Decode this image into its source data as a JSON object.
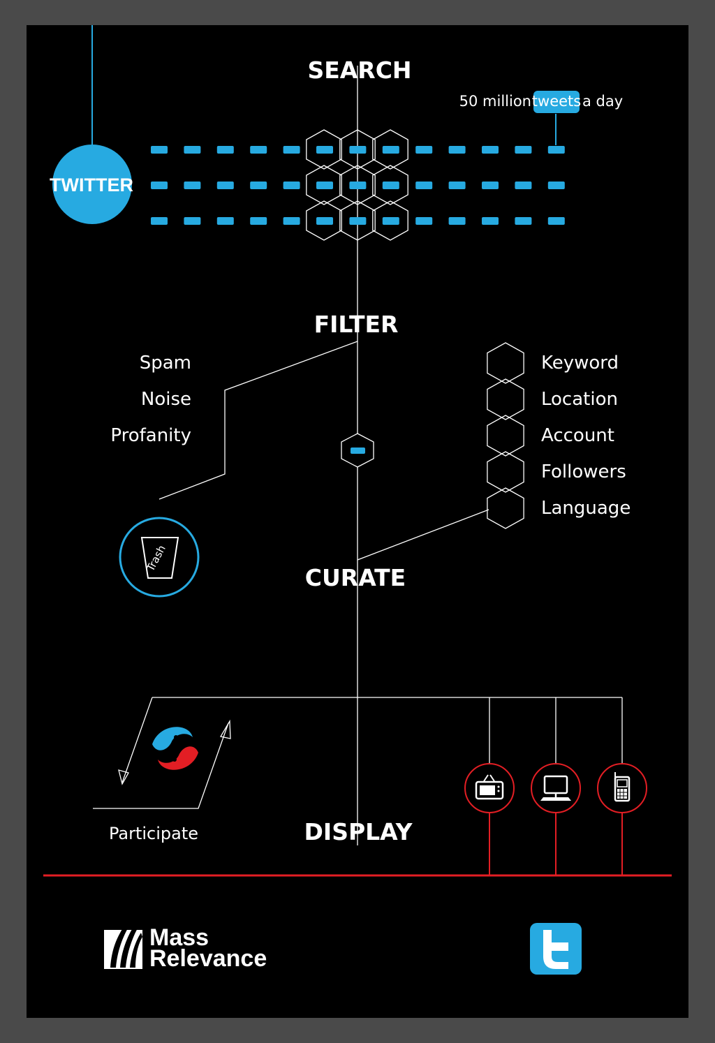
{
  "steps": {
    "search": "SEARCH",
    "filter": "FILTER",
    "curate": "CURATE",
    "display": "DISPLAY"
  },
  "source": {
    "label": "TWITTER",
    "stat_prefix": "50 million",
    "stat_highlight": "tweets",
    "stat_suffix": "a day"
  },
  "filter": {
    "removed": [
      "Spam",
      "Noise",
      "Profanity"
    ],
    "criteria": [
      "Keyword",
      "Location",
      "Account",
      "Followers",
      "Language"
    ],
    "trash_label": "Trash"
  },
  "display": {
    "participate_label": "Participate",
    "devices": [
      "tv-icon",
      "computer-icon",
      "mobile-phone-icon"
    ]
  },
  "branding": {
    "mass_relevance_line1": "Mass",
    "mass_relevance_line2": "Relevance"
  },
  "colors": {
    "accent_blue": "#27aae1",
    "accent_red": "#e31e24",
    "background": "#000000",
    "frame": "#4a4a4a"
  }
}
